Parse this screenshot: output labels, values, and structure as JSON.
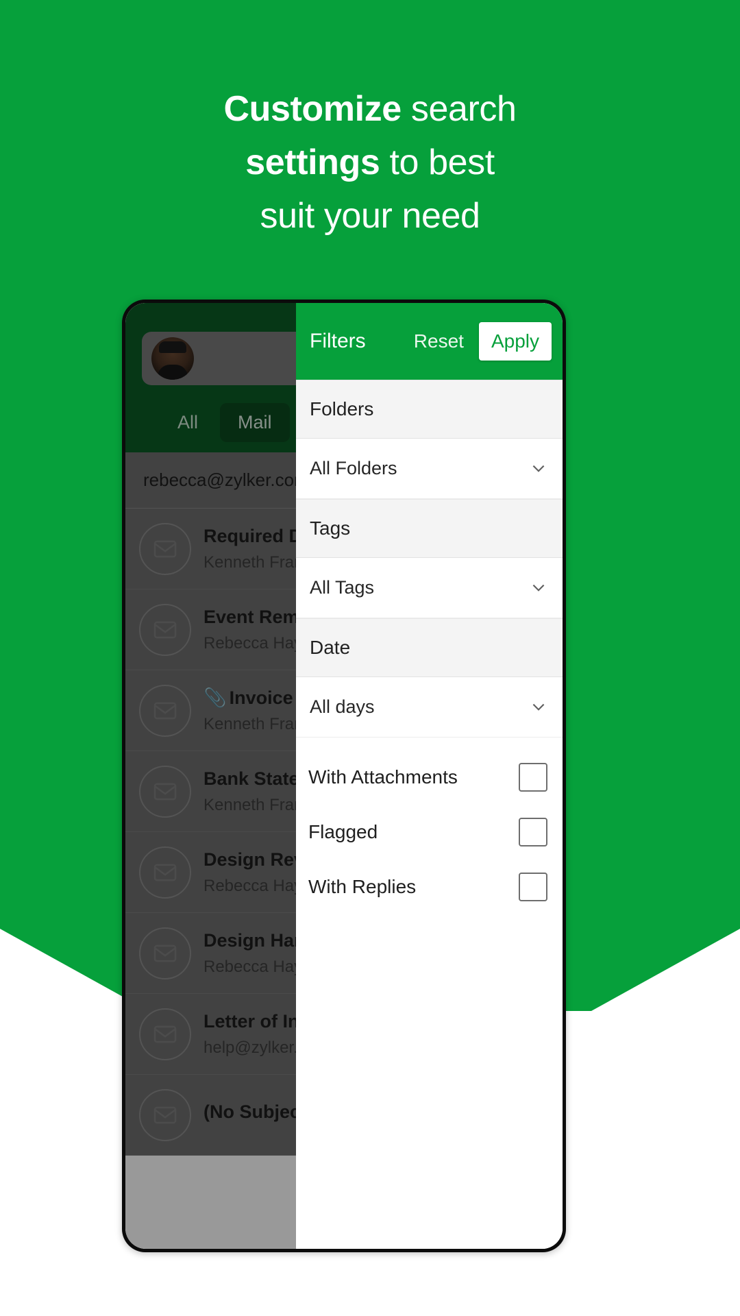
{
  "theme": {
    "brand_green": "#06a03b",
    "dark_green": "#0b5d25",
    "white": "#ffffff"
  },
  "headline": {
    "line1_bold": "Customize",
    "line1_rest": " search",
    "line2_bold": "settings",
    "line2_rest": " to best",
    "line3": "suit your need"
  },
  "app": {
    "tabs": [
      {
        "label": "All",
        "active": false
      },
      {
        "label": "Mail",
        "active": true
      }
    ],
    "account": "rebecca@zylker.com",
    "mail_icon": "envelope-icon",
    "emails": [
      {
        "subject": "Required Documents",
        "from": "Kenneth Frank",
        "attachment": false
      },
      {
        "subject": "Event Reminder",
        "from": "Rebecca Hayes",
        "attachment": false
      },
      {
        "subject": "Invoice Attached",
        "from": "Kenneth Frank",
        "attachment": true
      },
      {
        "subject": "Bank Statement",
        "from": "Kenneth Frank",
        "attachment": false
      },
      {
        "subject": "Design Review",
        "from": "Rebecca Hayes",
        "attachment": false
      },
      {
        "subject": "Design Handoff",
        "from": "Rebecca Hayes",
        "attachment": false
      },
      {
        "subject": "Letter of Intent",
        "from": "help@zylker.com",
        "attachment": false
      },
      {
        "subject": "(No Subject)",
        "from": "",
        "attachment": false
      }
    ]
  },
  "filters": {
    "title": "Filters",
    "reset_label": "Reset",
    "apply_label": "Apply",
    "sections": [
      {
        "header": "Folders",
        "value": "All Folders",
        "chevron": "chevron-down-icon"
      },
      {
        "header": "Tags",
        "value": "All Tags",
        "chevron": "chevron-down-icon"
      },
      {
        "header": "Date",
        "value": "All days",
        "chevron": "chevron-down-icon"
      }
    ],
    "checkboxes": [
      {
        "label": "With Attachments",
        "checked": false
      },
      {
        "label": "Flagged",
        "checked": false
      },
      {
        "label": "With Replies",
        "checked": false
      }
    ]
  }
}
